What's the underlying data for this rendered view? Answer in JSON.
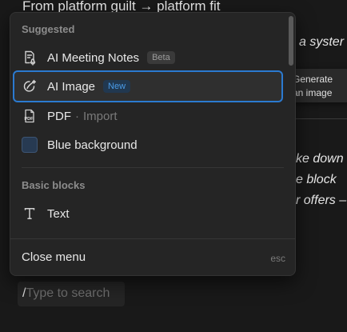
{
  "document": {
    "heading": "From platform guilt → platform fit",
    "lines": [
      "a syster",
      "ke down",
      "e block",
      "r offers –"
    ]
  },
  "menu": {
    "sections": {
      "suggested": "Suggested",
      "basic_blocks": "Basic blocks"
    },
    "items": [
      {
        "label": "AI Meeting Notes",
        "badge": "Beta",
        "icon": "meeting-notes-icon"
      },
      {
        "label": "AI Image",
        "badge": "New",
        "icon": "ai-image-icon",
        "active": true
      },
      {
        "label": "PDF",
        "subtext": "Import",
        "separator": "·",
        "icon": "pdf-icon"
      },
      {
        "label": "Blue background",
        "icon": "blue-swatch",
        "swatch_color": "#273a52"
      },
      {
        "label": "Text",
        "icon": "text-icon"
      }
    ],
    "close_label": "Close menu",
    "close_shortcut": "esc"
  },
  "tooltip": {
    "text": "Generate an image with AI"
  },
  "slash_input": {
    "slash": "/",
    "placeholder": "Type to search"
  },
  "colors": {
    "background": "#191919",
    "menu_background": "#252525",
    "accent_border": "#2b7ad0",
    "new_badge_text": "#4a9be8"
  }
}
